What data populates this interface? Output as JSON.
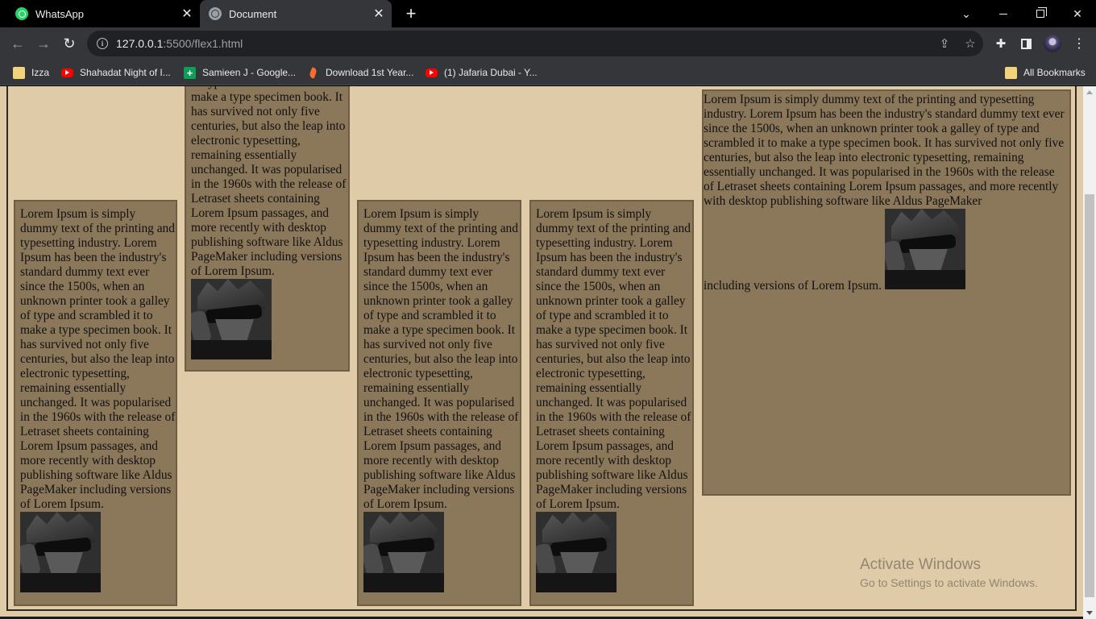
{
  "tabs": [
    {
      "label": "WhatsApp",
      "icon": "whatsapp-icon",
      "active": false
    },
    {
      "label": "Document",
      "icon": "globe-icon",
      "active": true
    }
  ],
  "address_bar": {
    "host": "127.0.0.1",
    "path": ":5500/flex1.html"
  },
  "bookmarks": [
    {
      "label": "Izza",
      "icon": "folder-icon"
    },
    {
      "label": "Shahadat Night of I...",
      "icon": "youtube-icon"
    },
    {
      "label": "Samieen J - Google...",
      "icon": "google-sheets-icon"
    },
    {
      "label": "Download 1st Year...",
      "icon": "download-site-icon"
    },
    {
      "label": "(1) Jafaria Dubai - Y...",
      "icon": "youtube-icon"
    },
    {
      "label": "All Bookmarks",
      "icon": "folder-icon"
    }
  ],
  "page": {
    "lorem": "Lorem Ipsum is simply dummy text of the printing and typesetting industry. Lorem Ipsum has been the industry's standard dummy text ever since the 1500s, when an unknown printer took a galley of type and scrambled it to make a type specimen book. It has survived not only five centuries, but also the leap into electronic typesetting, remaining essentially unchanged. It was popularised in the 1960s with the release of Letraset sheets containing Lorem Ipsum passages, and more recently with desktop publishing software like Aldus PageMaker including versions of Lorem Ipsum.",
    "lorem_wide_before": "Lorem Ipsum is simply dummy text of the printing and typesetting industry. Lorem Ipsum has been the industry's standard dummy text ever since the 1500s, when an unknown printer took a galley of type and scrambled it to make a type specimen book. It has survived not only five centuries, but also the leap into electronic typesetting, remaining essentially unchanged. It was popularised in the 1960s with the release of Letraset sheets containing Lorem Ipsum passages, and more recently with desktop publishing software like Aldus PageMaker",
    "lorem_wide_after": "including versions of Lorem Ipsum.",
    "background_color": "#e0cba9",
    "card_color": "#8b775a"
  },
  "watermark": {
    "title": "Activate Windows",
    "subtitle": "Go to Settings to activate Windows."
  }
}
